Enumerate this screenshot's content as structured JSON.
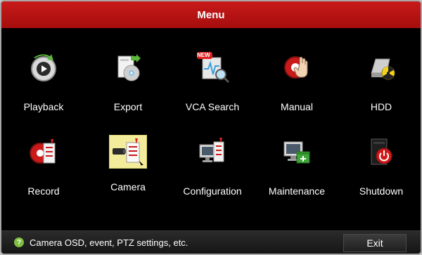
{
  "window": {
    "title": "Menu"
  },
  "menu": {
    "items": [
      {
        "label": "Playback",
        "icon": "playback-icon"
      },
      {
        "label": "Export",
        "icon": "export-icon"
      },
      {
        "label": "VCA Search",
        "icon": "vca-search-icon",
        "badge": "NEW"
      },
      {
        "label": "Manual",
        "icon": "manual-record-icon"
      },
      {
        "label": "HDD",
        "icon": "hdd-icon"
      },
      {
        "label": "Record",
        "icon": "record-icon"
      },
      {
        "label": "Camera",
        "icon": "camera-icon",
        "selected": true
      },
      {
        "label": "Configuration",
        "icon": "configuration-icon"
      },
      {
        "label": "Maintenance",
        "icon": "maintenance-icon"
      },
      {
        "label": "Shutdown",
        "icon": "shutdown-icon"
      }
    ]
  },
  "status": {
    "hint": "Camera OSD, event, PTZ settings, etc.",
    "hint_icon": "help-icon"
  },
  "exit_label": "Exit",
  "colors": {
    "title_bar": "#b01212",
    "selected_tile": "#f3ec9a",
    "hint_icon": "#7fbf3f"
  }
}
